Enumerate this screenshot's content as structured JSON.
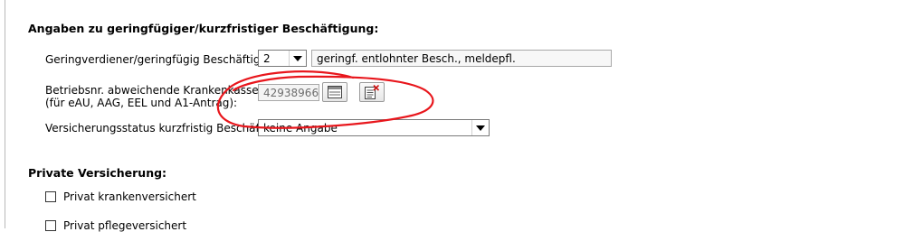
{
  "sections": {
    "employment_heading": "Angaben zu geringfügiger/kurzfristiger Beschäftigung:",
    "private_heading": "Private Versicherung:"
  },
  "rows": {
    "geringverdiener": {
      "label": "Geringverdiener/geringfügig Beschäftigte:",
      "value": "2",
      "description": "geringf. entlohnter Besch., meldepfl."
    },
    "betriebsnr": {
      "label_line1": "Betriebsnr. abweichende Krankenkasse",
      "label_line2": "(für eAU, AAG, EEL und A1-Antrag):",
      "value": "42938966"
    },
    "versicherungsstatus": {
      "label": "Versicherungsstatus kurzfristig Beschäftigte:",
      "value": "keine Angabe"
    }
  },
  "checkboxes": {
    "kranken": "Privat krankenversichert",
    "pflege": "Privat pflegeversichert"
  },
  "icons": {
    "list": "list-table-icon",
    "delete": "document-delete-icon"
  },
  "colors": {
    "annotation": "#e8161c"
  }
}
